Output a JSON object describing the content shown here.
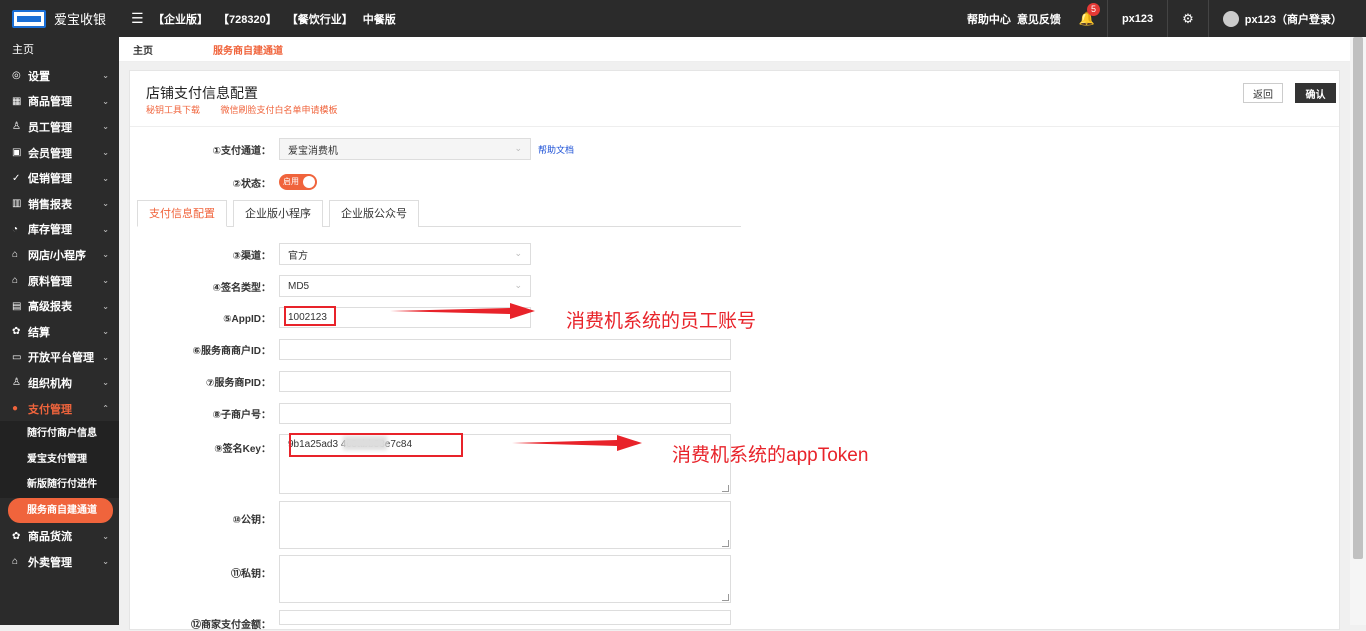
{
  "app": {
    "name": "爱宝收银"
  },
  "topbar": {
    "crumbs": [
      "【企业版】",
      "【728320】",
      "【餐饮行业】",
      "中餐版"
    ],
    "help_center": "帮助中心",
    "feedback": "意见反馈",
    "notification_count": "5",
    "user": "px123",
    "account": "px123（商户登录）"
  },
  "sidebar": {
    "home": "主页",
    "items": [
      {
        "label": "设置",
        "icon": "gear-icon"
      },
      {
        "label": "商品管理",
        "icon": "grid-icon"
      },
      {
        "label": "员工管理",
        "icon": "user-icon"
      },
      {
        "label": "会员管理",
        "icon": "card-icon"
      },
      {
        "label": "促销管理",
        "icon": "check-circle-icon"
      },
      {
        "label": "销售报表",
        "icon": "bar-chart-icon"
      },
      {
        "label": "库存管理",
        "icon": "pie-chart-icon"
      },
      {
        "label": "网店/小程序",
        "icon": "store-icon"
      },
      {
        "label": "原料管理",
        "icon": "store-icon"
      },
      {
        "label": "高级报表",
        "icon": "line-chart-icon"
      },
      {
        "label": "结算",
        "icon": "settle-icon"
      },
      {
        "label": "开放平台管理",
        "icon": "monitor-icon"
      },
      {
        "label": "组织机构",
        "icon": "org-icon"
      },
      {
        "label": "支付管理",
        "icon": "payment-icon"
      }
    ],
    "sub_items": [
      "随行付商户信息",
      "爱宝支付管理",
      "新版随行付进件",
      "服务商自建通道"
    ],
    "items_after": [
      {
        "label": "商品货流",
        "icon": "flow-icon"
      },
      {
        "label": "外卖管理",
        "icon": "store-icon"
      }
    ]
  },
  "tabbar": {
    "home": "主页",
    "current": "服务商自建通道"
  },
  "panel": {
    "title": "店铺支付信息配置",
    "link_tool": "秘钥工具下载",
    "link_template": "微信刷脸支付白名单申请模板",
    "back_button": "返回",
    "confirm_button": "确认"
  },
  "form": {
    "channel_label": "①支付通道：",
    "channel_value": "爱宝消费机",
    "help_doc": "帮助文档",
    "status_label": "②状态：",
    "status_value": "启用",
    "tabs": [
      "支付信息配置",
      "企业版小程序",
      "企业版公众号"
    ],
    "route_label": "③渠道：",
    "route_value": "官方",
    "sign_type_label": "④签名类型：",
    "sign_type_value": "MD5",
    "appid_label": "⑤AppID：",
    "appid_value": "1002123",
    "sp_merchant_label": "⑥服务商商户ID：",
    "sp_pid_label": "⑦服务商PID：",
    "sub_merchant_label": "⑧子商户号：",
    "sign_key_label": "⑨签名Key：",
    "sign_key_value": "9b1a25ad3          4c3abb33e7c84",
    "public_key_label": "⑩公钥：",
    "private_key_label": "⑪私钥：",
    "merchant_label": "⑫商家支付金额："
  },
  "annotations": {
    "appid_note": "消费机系统的员工账号",
    "key_note": "消费机系统的appToken"
  },
  "colors": {
    "accent": "#f0643c",
    "dark": "#2b2b2b",
    "annotation": "#e8232a"
  }
}
